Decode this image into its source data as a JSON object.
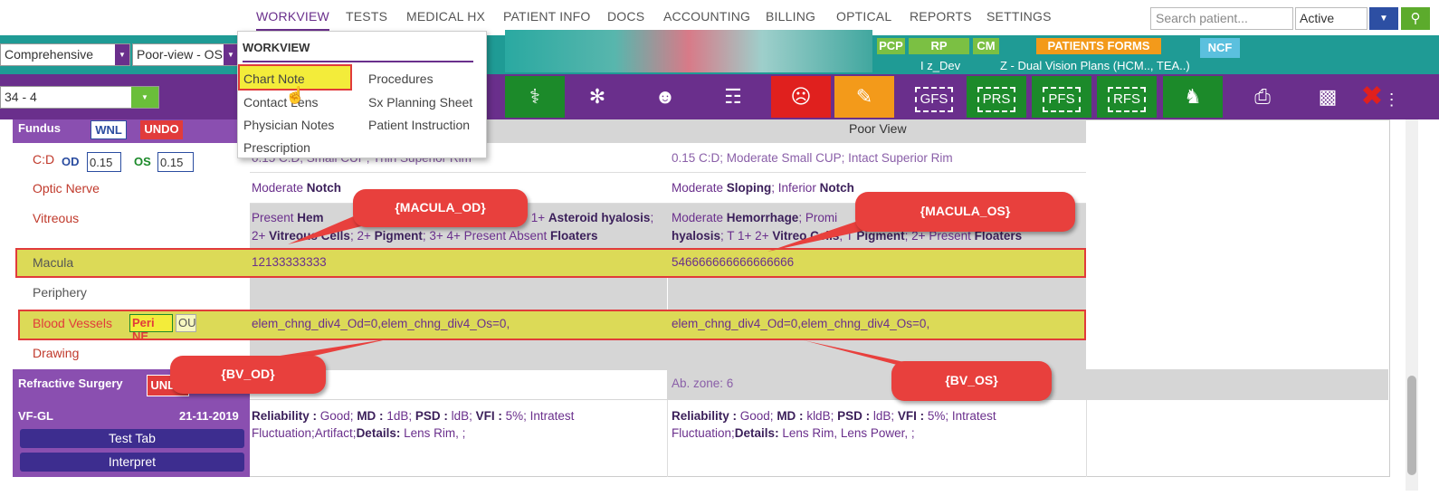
{
  "nav": {
    "items": [
      "WORKVIEW",
      "TESTS",
      "MEDICAL HX",
      "PATIENT INFO",
      "DOCS",
      "ACCOUNTING",
      "BILLING",
      "OPTICAL",
      "REPORTS",
      "SETTINGS"
    ],
    "search_placeholder": "Search patient...",
    "status": "Active"
  },
  "toolbar": {
    "exam_type": "Comprehensive",
    "view_select": "Poor-view - OS",
    "visit": "34 - 4",
    "badges": {
      "pcp": "PCP",
      "rp": "RP",
      "cm": "CM",
      "patients_forms": "PATIENTS FORMS",
      "ncf": "NCF"
    },
    "provider": "I z_Dev",
    "insurance": "Z - Dual Vision Plans (HCM.., TEA..)",
    "icons": [
      "GFS",
      "PRS",
      "PFS",
      "RFS"
    ]
  },
  "menu": {
    "header": "WORKVIEW",
    "col1": [
      "Chart Note",
      "Contact Lens",
      "Physician Notes",
      "Prescription"
    ],
    "col2": [
      "Procedures",
      "Sx Planning Sheet",
      "Patient Instruction"
    ]
  },
  "fundus": {
    "title": "Fundus",
    "wnl": "WNL",
    "undo": "UNDO",
    "poor_view": "Poor View",
    "cd_label": "C:D",
    "od_label": "OD",
    "os_label": "OS",
    "cd_od": "0.15",
    "cd_os": "0.15",
    "rows": {
      "cd": {
        "od": "0.15 C:D; Small CUP; Thin Superior Rim",
        "os": "0.15 C:D; Moderate Small CUP; Intact Superior Rim"
      },
      "optic_nerve": {
        "label": "Optic Nerve",
        "od_pre": "Moderate ",
        "od_b": "Notch",
        "os_pre": "Moderate ",
        "os_b": "Sloping",
        "os_mid": "; Inferior ",
        "os_b2": "Notch"
      },
      "vitreous": {
        "label": "Vitreous",
        "od_l1_pre": "Present ",
        "od_l1_b": "Hem",
        "od_l1_mid": "T 1+ ",
        "od_l1_b2": "Asteroid hyalosis",
        "od_l1_end": ";",
        "od_l2_pre": "2+ ",
        "od_l2_b": "Vitreous Cells",
        "od_l2_mid": "; 2+ ",
        "od_l2_b2": "Pigment",
        "od_l2_mid2": "; 3+ 4+ Present Absent ",
        "od_l2_b3": "Floaters",
        "os_l1_pre": "Moderate ",
        "os_l1_b": "Hemorrhage",
        "os_l1_end": "; Promi",
        "os_l2_b": "hyalosis",
        "os_l2_mid": "; T 1+ 2+ ",
        "os_l2_b2": "Vitreo",
        "os_l2_b3": "Cells",
        "os_l2_mid2": "; T ",
        "os_l2_b4": "Pigment",
        "os_l2_mid3": "; 2+ Present ",
        "os_l2_b5": "Floaters"
      },
      "macula": {
        "label": "Macula",
        "od": "12133333333",
        "os": "546666666666666666"
      },
      "periphery": {
        "label": "Periphery"
      },
      "blood_vessels": {
        "label": "Blood Vessels",
        "peri_ne": "Peri NE",
        "ou": "OU",
        "od": "elem_chng_div4_Od=0,elem_chng_div4_Os=0,",
        "os": "elem_chng_div4_Od=0,elem_chng_div4_Os=0,"
      },
      "drawing": {
        "label": "Drawing"
      }
    }
  },
  "refractive": {
    "title": "Refractive Surgery",
    "undo": "UNDO",
    "os": "Ab. zone: 6"
  },
  "vfgl": {
    "title": "VF-GL",
    "date": "21-11-2019",
    "test_tab": "Test Tab",
    "interpret": "Interpret",
    "od_l1": [
      [
        "Reliability : ",
        "b"
      ],
      [
        "Good; ",
        ""
      ],
      [
        "MD : ",
        "b"
      ],
      [
        "1dB; ",
        ""
      ],
      [
        "PSD : ",
        "b"
      ],
      [
        "ldB; ",
        ""
      ],
      [
        "VFI : ",
        "b"
      ],
      [
        "5%; Intratest",
        ""
      ]
    ],
    "od_l2": [
      [
        "Fluctuation;Artifact;",
        ""
      ],
      [
        "Details: ",
        "b"
      ],
      [
        "Lens Rim, ;",
        ""
      ]
    ],
    "os_l1": [
      [
        "Reliability : ",
        "b"
      ],
      [
        "Good; ",
        ""
      ],
      [
        "MD : ",
        "b"
      ],
      [
        "kldB; ",
        ""
      ],
      [
        "PSD : ",
        "b"
      ],
      [
        "ldB; ",
        ""
      ],
      [
        "VFI : ",
        "b"
      ],
      [
        "5%; Intratest",
        ""
      ]
    ],
    "os_l2": [
      [
        "Fluctuation;",
        ""
      ],
      [
        "Details: ",
        "b"
      ],
      [
        "Lens Rim, Lens Power, ;",
        ""
      ]
    ]
  },
  "callouts": {
    "macula_od": "{MACULA_OD}",
    "macula_os": "{MACULA_OS}",
    "bv_od": "{BV_OD}",
    "bv_os": "{BV_OS}"
  }
}
